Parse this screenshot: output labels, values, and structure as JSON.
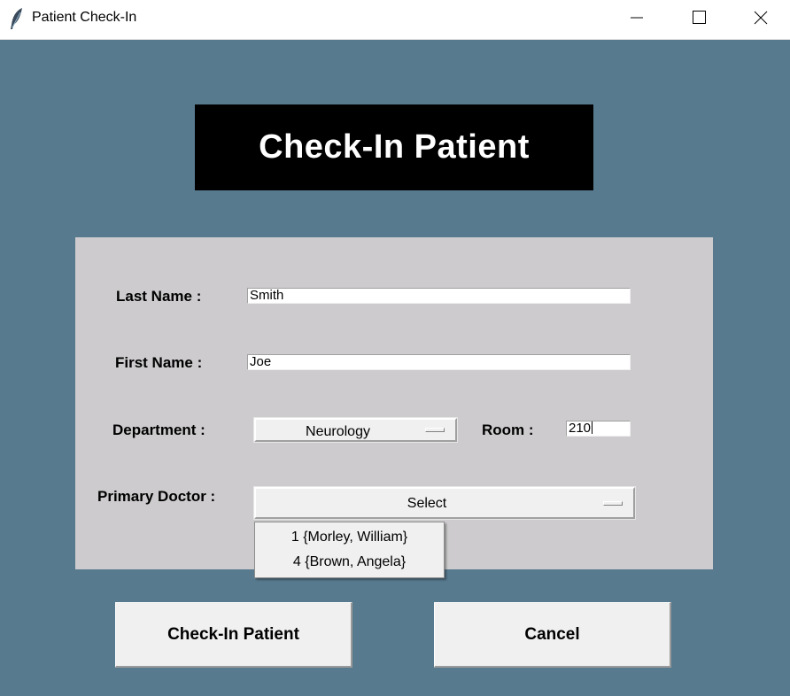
{
  "window": {
    "title": "Patient Check-In",
    "icon": "feather-icon",
    "controls": [
      "minimize-icon",
      "maximize-icon",
      "close-icon"
    ]
  },
  "header": {
    "title": "Check-In Patient"
  },
  "form": {
    "last_name": {
      "label": "Last Name :",
      "value": "Smith"
    },
    "first_name": {
      "label": "First Name :",
      "value": "Joe"
    },
    "department": {
      "label": "Department :",
      "value": "Neurology"
    },
    "room": {
      "label": "Room :",
      "value": "210"
    },
    "primary_doctor": {
      "label": "Primary Doctor :",
      "value": "Select",
      "options": [
        "1 {Morley, William}",
        "4 {Brown, Angela}"
      ]
    }
  },
  "buttons": {
    "check_in": "Check-In Patient",
    "cancel": "Cancel"
  },
  "colors": {
    "background": "#587a8f",
    "panel": "#cdcbcd",
    "banner": "#000000",
    "button_face": "#f0f0f0"
  }
}
